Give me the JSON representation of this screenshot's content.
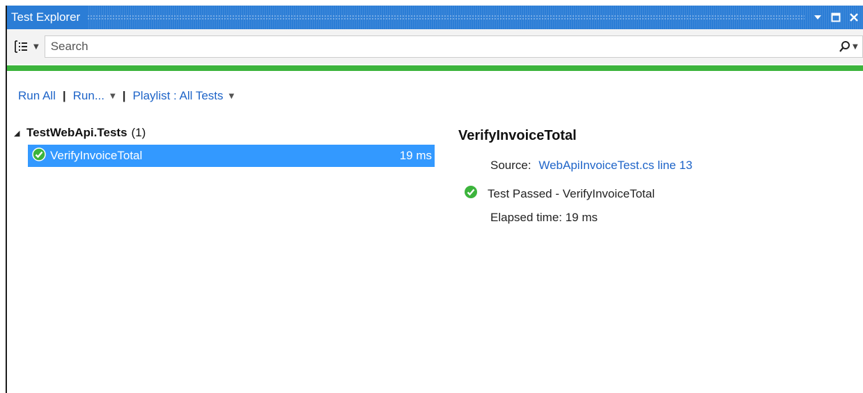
{
  "window": {
    "title": "Test Explorer"
  },
  "toolbar": {
    "search_placeholder": "Search",
    "progress_fraction": 1.0,
    "progress_color": "#3cb43c"
  },
  "commands": {
    "run_all": "Run All",
    "run": "Run...",
    "playlist": "Playlist : All Tests"
  },
  "tree": {
    "group_name": "TestWebApi.Tests",
    "group_count": "(1)",
    "tests": [
      {
        "name": "VerifyInvoiceTotal",
        "duration": "19 ms",
        "status": "passed"
      }
    ]
  },
  "details": {
    "title": "VerifyInvoiceTotal",
    "source_label": "Source:",
    "source_link": "WebApiInvoiceTest.cs line 13",
    "result_text": "Test Passed - VerifyInvoiceTotal",
    "elapsed": "Elapsed time: 19 ms"
  },
  "colors": {
    "accent": "#2b7dd6",
    "selection": "#3399ff",
    "link": "#1e64c8",
    "pass": "#3cb43c"
  }
}
